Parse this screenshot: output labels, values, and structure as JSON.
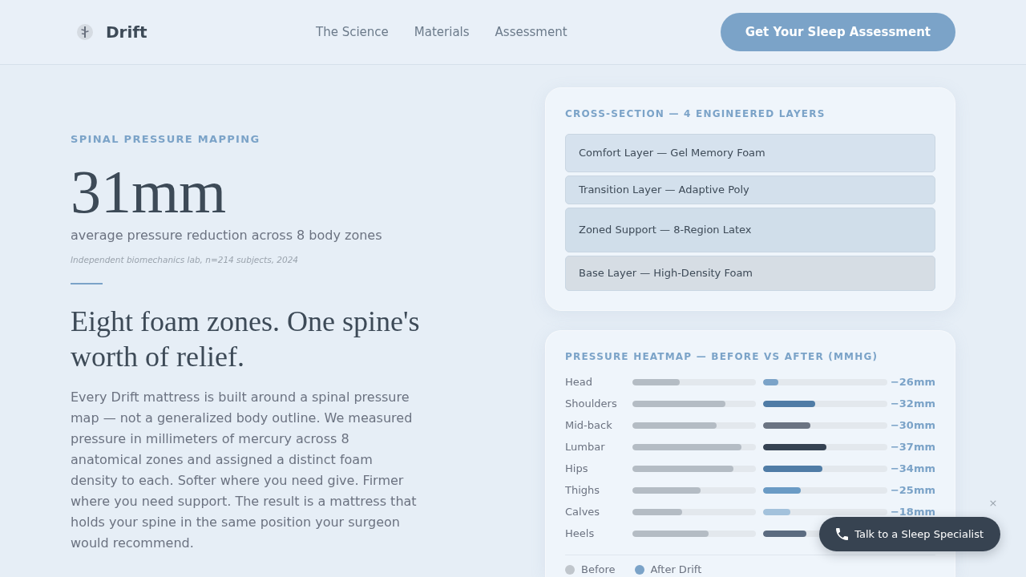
{
  "header": {
    "logo": "Drift",
    "nav": [
      {
        "label": "The Science"
      },
      {
        "label": "Materials"
      },
      {
        "label": "Assessment"
      }
    ],
    "cta": "Get Your Sleep Assessment"
  },
  "hero": {
    "eyebrow": "SPINAL PRESSURE MAPPING",
    "stat": "31mm",
    "stat_caption": "average pressure reduction across 8 body zones",
    "source": "Independent biomechanics lab, n=214 subjects, 2024",
    "heading": "Eight foam zones. One spine's worth of relief.",
    "body": "Every Drift mattress is built around a spinal pressure map — not a generalized body outline. We measured pressure in millimeters of mercury across 8 anatomical zones and assigned a distinct foam density to each. Softer where you need give. Firmer where you need support. The result is a mattress that holds your spine in the same position your surgeon would recommend."
  },
  "cross_section": {
    "title": "CROSS-SECTION — 4 ENGINEERED LAYERS",
    "layers": [
      {
        "label": "Comfort Layer — Gel Memory Foam",
        "color": "#d6e2ee"
      },
      {
        "label": "Transition Layer — Adaptive Poly",
        "color": "#d3e0ec"
      },
      {
        "label": "Zoned Support — 8-Region Latex",
        "color": "#d0deea"
      },
      {
        "label": "Base Layer — High-Density Foam",
        "color": "#d6dde4"
      }
    ]
  },
  "heatmap": {
    "title": "PRESSURE HEATMAP — BEFORE VS AFTER (MMHG)",
    "rows": [
      {
        "zone": "Head",
        "before": {
          "level": 0.38
        },
        "after": {
          "level": 0.12,
          "color": "#7ba3c8"
        },
        "change": "−26mm"
      },
      {
        "zone": "Shoulders",
        "before": {
          "level": 0.75
        },
        "after": {
          "level": 0.42,
          "color": "#4f7ca6"
        },
        "change": "−32mm"
      },
      {
        "zone": "Mid-back",
        "before": {
          "level": 0.68
        },
        "after": {
          "level": 0.38,
          "color": "#6b7482"
        },
        "change": "−30mm"
      },
      {
        "zone": "Lumbar",
        "before": {
          "level": 0.88
        },
        "after": {
          "level": 0.51,
          "color": "#354252"
        },
        "change": "−37mm"
      },
      {
        "zone": "Hips",
        "before": {
          "level": 0.82
        },
        "after": {
          "level": 0.48,
          "color": "#4f7ca6"
        },
        "change": "−34mm"
      },
      {
        "zone": "Thighs",
        "before": {
          "level": 0.55
        },
        "after": {
          "level": 0.3,
          "color": "#6a9bc5"
        },
        "change": "−25mm"
      },
      {
        "zone": "Calves",
        "before": {
          "level": 0.4
        },
        "after": {
          "level": 0.22,
          "color": "#a3c2dc"
        },
        "change": "−18mm"
      },
      {
        "zone": "Heels",
        "before": {
          "level": 0.62
        },
        "after": {
          "level": 0.35,
          "color": "#5b6b80"
        }
      }
    ],
    "legend": [
      {
        "label": "Before",
        "color": "#c0c6cc"
      },
      {
        "label": "After Drift",
        "color": "#7ba3c8"
      }
    ]
  },
  "specialist": {
    "label": "Talk to a Sleep Specialist",
    "close": "×"
  }
}
